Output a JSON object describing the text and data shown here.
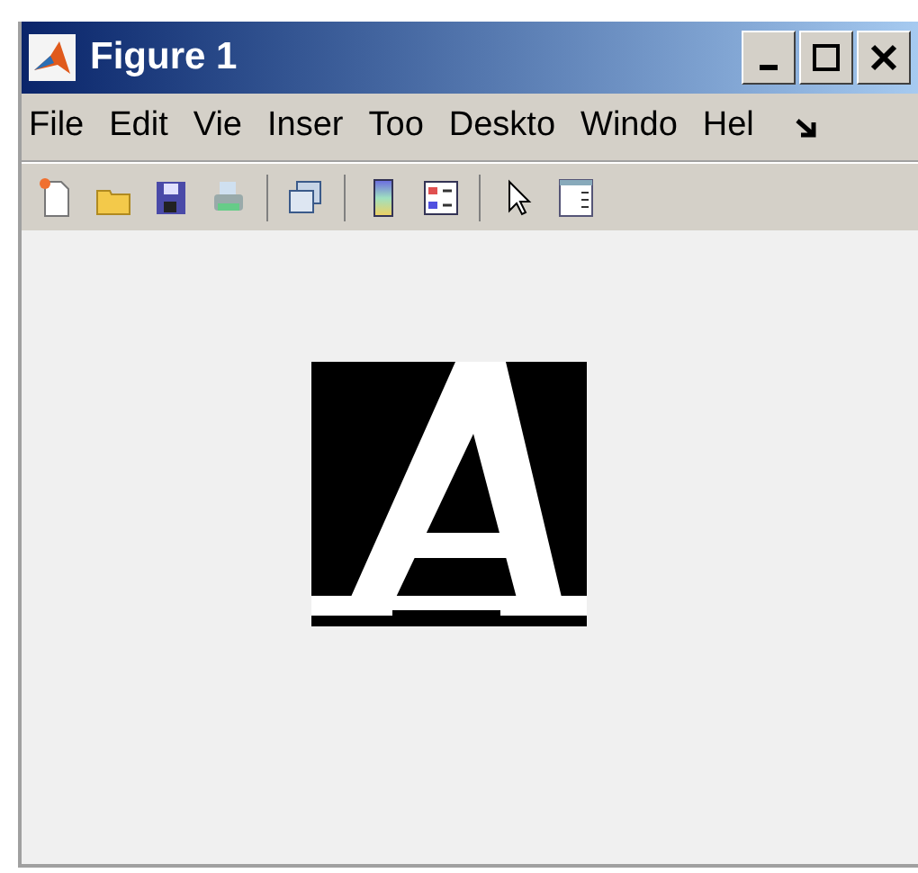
{
  "window": {
    "title": "Figure 1"
  },
  "menu": [
    "File",
    "Edit",
    "Vie",
    "Inser",
    "Too",
    "Deskto",
    "Windo",
    "Hel"
  ]
}
